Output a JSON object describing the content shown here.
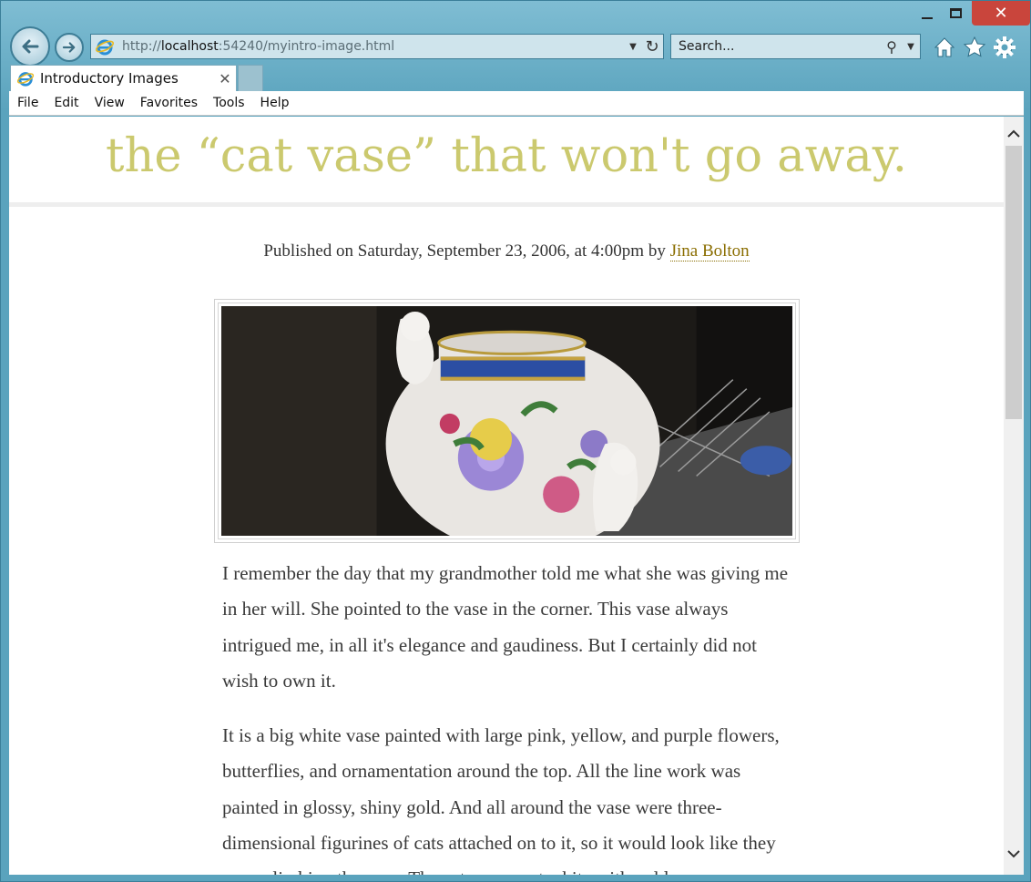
{
  "browser": {
    "url_prefix": "http://",
    "url_host": "localhost",
    "url_rest": ":54240/myintro-image.html",
    "search_placeholder": "Search...",
    "tab_title": "Introductory Images",
    "menu": [
      "File",
      "Edit",
      "View",
      "Favorites",
      "Tools",
      "Help"
    ]
  },
  "page": {
    "title": "the “cat vase” that won't go away.",
    "byline_prefix": "Published on Saturday, September 23, 2006, at 4:00pm by ",
    "author": "Jina Bolton",
    "paragraphs": [
      "I remember the day that my grandmother told me what she was giving me in her will. She pointed to the vase in the corner. This vase always intrigued me, in all it's elegance and gaudiness. But I certainly did not wish to own it.",
      "It is a big white vase painted with large pink, yellow, and purple flowers, butterflies, and ornamentation around the top. All the line work was painted in glossy, shiny gold. And all around the vase were three-dimensional figurines of cats attached on to it, so it would look like they were climbing the vase. The cats were not white with gold"
    ]
  },
  "colors": {
    "title": "#cbc96e",
    "author_link": "#8a6d00",
    "close_button": "#c9453c"
  }
}
